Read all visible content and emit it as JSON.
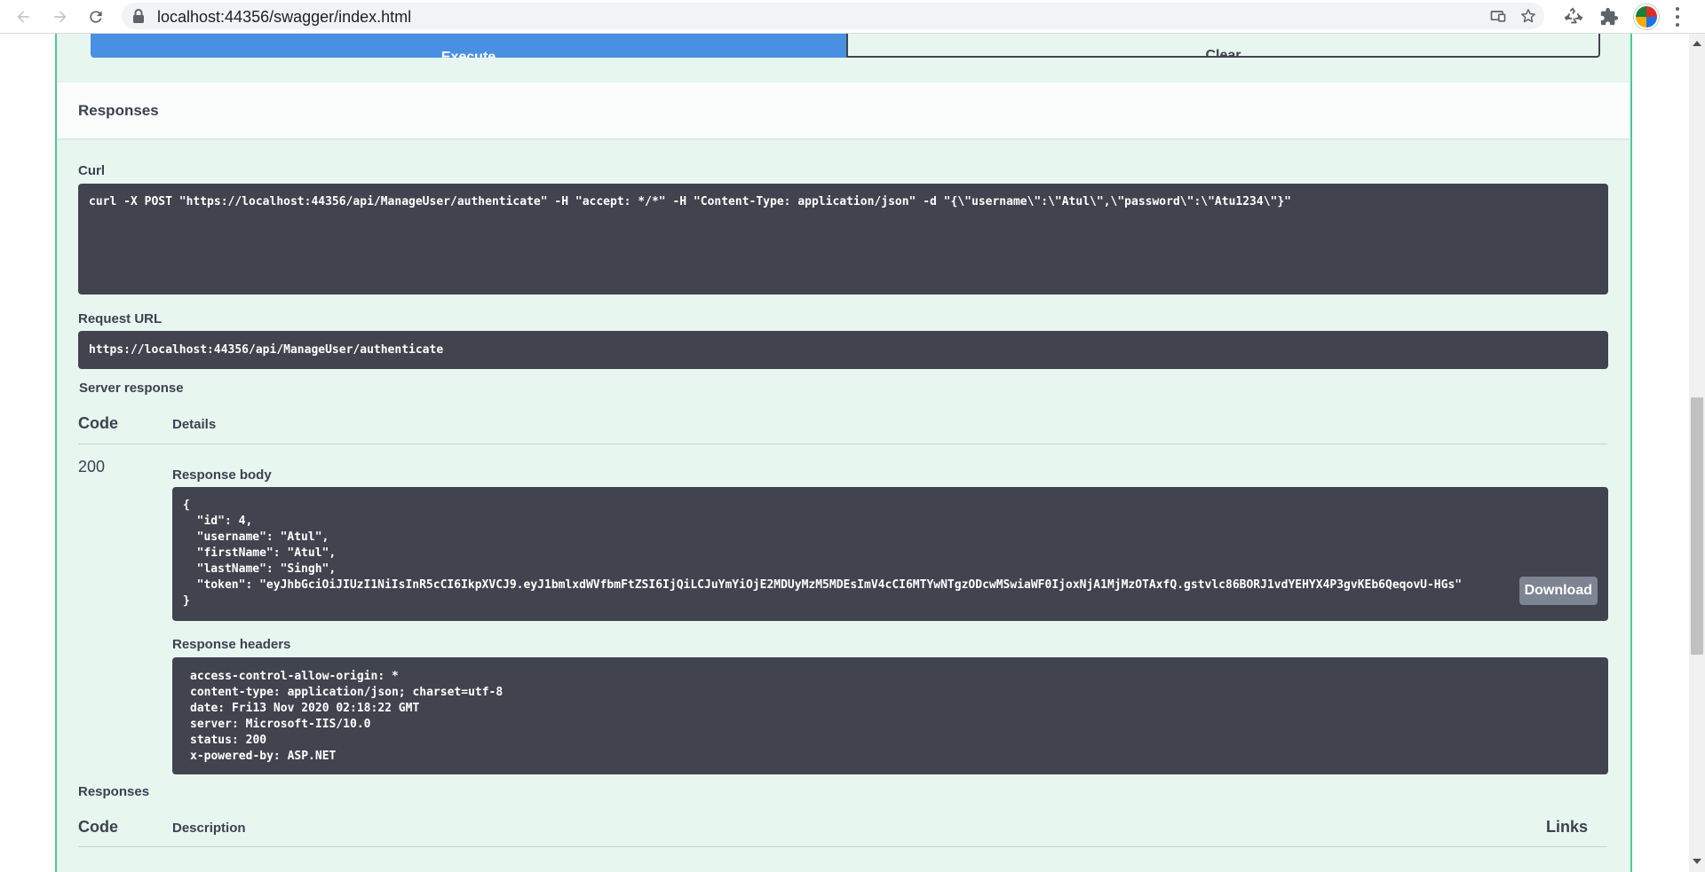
{
  "browser": {
    "url": "localhost:44356/swagger/index.html",
    "icons": [
      "back-arrow-icon",
      "forward-arrow-icon",
      "reload-icon",
      "lock-icon",
      "cast-icon",
      "star-icon",
      "recycle-extension-icon",
      "puzzle-extensions-icon",
      "profile-avatar",
      "menu-dots-icon"
    ]
  },
  "toolbar": {
    "execute_label": "Execute",
    "clear_label": "Clear"
  },
  "responses_section": {
    "title": "Responses",
    "curl_label": "Curl",
    "curl_command": "curl -X POST \"https://localhost:44356/api/ManageUser/authenticate\" -H \"accept: */*\" -H \"Content-Type: application/json\" -d \"{\\\"username\\\":\\\"Atul\\\",\\\"password\\\":\\\"Atu1234\\\"}\"",
    "request_url_label": "Request URL",
    "request_url": "https://localhost:44356/api/ManageUser/authenticate",
    "server_response_label": "Server response",
    "code_header": "Code",
    "details_header": "Details",
    "status_code": "200",
    "response_body_label": "Response body",
    "response_body_lines": [
      "{",
      "  \"id\": 4,",
      "  \"username\": \"Atul\",",
      "  \"firstName\": \"Atul\",",
      "  \"lastName\": \"Singh\",",
      "  \"token\": \"eyJhbGciOiJIUzI1NiIsInR5cCI6IkpXVCJ9.eyJ1bmlxdWVfbmFtZSI6IjQiLCJuYmYiOjE2MDUyMzM5MDEsImV4cCI6MTYwNTgzODcwMSwiaWF0IjoxNjA1MjMzOTAxfQ.gstvlc86BORJ1vdYEHYX4P3gvKEb6QeqovU-HGs\"",
      "}"
    ],
    "download_label": "Download",
    "response_headers_label": "Response headers",
    "response_headers_lines": [
      "access-control-allow-origin: *",
      "content-type: application/json; charset=utf-8",
      "date: Fri13 Nov 2020 02:18:22 GMT",
      "server: Microsoft-IIS/10.0",
      "status: 200",
      "x-powered-by: ASP.NET"
    ]
  },
  "responses_table": {
    "title": "Responses",
    "code_header": "Code",
    "description_header": "Description",
    "links_header": "Links"
  },
  "colors": {
    "post_green": "#49cc90",
    "block_bg": "#e8f6f0",
    "execute_blue": "#4990e2",
    "code_bg": "#41444e"
  }
}
